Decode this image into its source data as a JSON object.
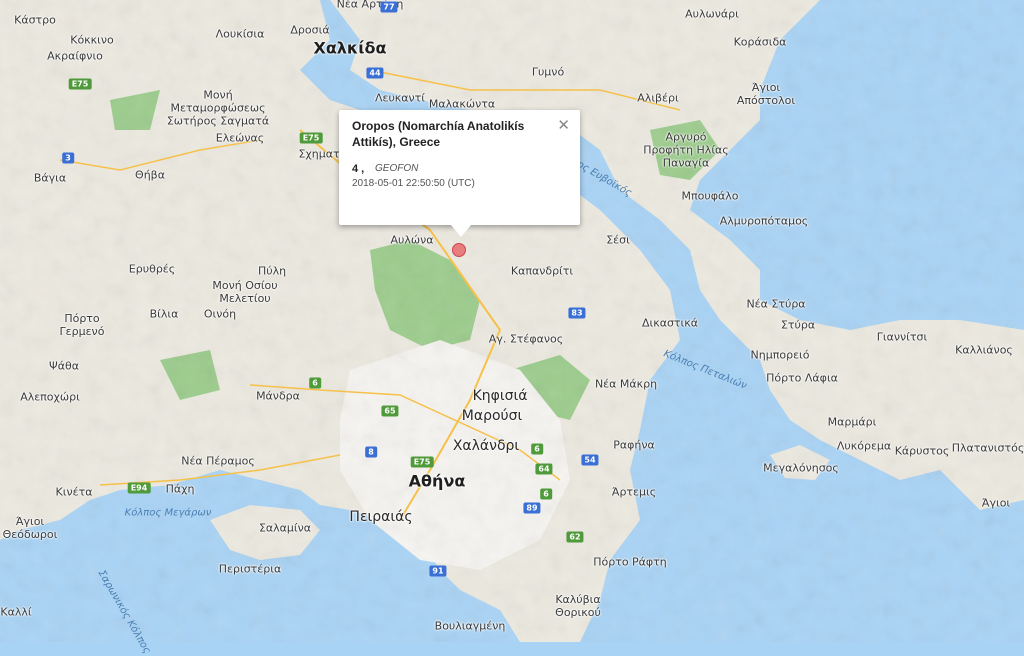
{
  "popup": {
    "title": "Oropos (Nomarchía Anatolikís Attikís), Greece",
    "magnitude": "4 ,",
    "source": "GEOFON",
    "time": "2018-05-01 22:50:50 (UTC)",
    "close_icon": "close-icon"
  },
  "marker": {
    "icon": "earthquake-marker-icon",
    "color": "#e77d7d"
  },
  "colors": {
    "sea": "#a9d3f5",
    "land": "#ece9e0",
    "forest": "#9ccc8c",
    "urban": "#f4f2ee"
  },
  "places": [
    {
      "id": "kastro",
      "name": "Κάστρο"
    },
    {
      "id": "kokkino",
      "name": "Κόκκινο"
    },
    {
      "id": "akraifnio",
      "name": "Ακραίφνιο"
    },
    {
      "id": "loukisia",
      "name": "Λουκίσια"
    },
    {
      "id": "drosia",
      "name": "Δροσιά"
    },
    {
      "id": "chalkida",
      "name": "Χαλκίδα"
    },
    {
      "id": "nea-artaki",
      "name": "Νέα Αρτάκη"
    },
    {
      "id": "avlonari",
      "name": "Αυλωνάρι"
    },
    {
      "id": "korasida",
      "name": "Κοράσιδα"
    },
    {
      "id": "gymno",
      "name": "Γυμνό"
    },
    {
      "id": "moni-metamorfoseos",
      "name": "Μονή Μεταμορφώσεως Σωτήρος Σαγματά"
    },
    {
      "id": "lefkanti",
      "name": "Λευκαντί"
    },
    {
      "id": "malakonta",
      "name": "Μαλακώντα"
    },
    {
      "id": "aliveri",
      "name": "Αλιβέρι"
    },
    {
      "id": "agioi-apostoloi",
      "name": "Άγιοι Απόστολοι"
    },
    {
      "id": "eleonas",
      "name": "Ελεώνας"
    },
    {
      "id": "schimatari",
      "name": "Σχηματάρι"
    },
    {
      "id": "vagia",
      "name": "Βάγια"
    },
    {
      "id": "thiva",
      "name": "Θήβα"
    },
    {
      "id": "argyro",
      "name": "Αργυρό Προφήτη Ηλίας Παναγία"
    },
    {
      "id": "bouffalo",
      "name": "Μπουφάλο"
    },
    {
      "id": "almyropotamos",
      "name": "Αλμυροπόταμος"
    },
    {
      "id": "avlona",
      "name": "Αυλώνα"
    },
    {
      "id": "sesi",
      "name": "Σέσι"
    },
    {
      "id": "kapandriti",
      "name": "Καπανδρίτι"
    },
    {
      "id": "erythres",
      "name": "Ερυθρές"
    },
    {
      "id": "pyli",
      "name": "Πύλη"
    },
    {
      "id": "moni-osiou",
      "name": "Μονή Οσίου Μελετίου"
    },
    {
      "id": "porto-germeno",
      "name": "Πόρτο Γερμενό"
    },
    {
      "id": "vilia",
      "name": "Βίλια"
    },
    {
      "id": "oinoi",
      "name": "Οινόη"
    },
    {
      "id": "dikastika",
      "name": "Δικαστικά"
    },
    {
      "id": "nea-styra",
      "name": "Νέα Στύρα"
    },
    {
      "id": "styra",
      "name": "Στύρα"
    },
    {
      "id": "giannitsi",
      "name": "Γιαννίτσι"
    },
    {
      "id": "kallianos",
      "name": "Καλλιάνος"
    },
    {
      "id": "ag-stefanos",
      "name": "Αγ. Στέφανος"
    },
    {
      "id": "nimporeio",
      "name": "Νημπορειό"
    },
    {
      "id": "porto-lafia",
      "name": "Πόρτο Λάφια"
    },
    {
      "id": "psatha",
      "name": "Ψάθα"
    },
    {
      "id": "kifisia",
      "name": "Κηφισιά"
    },
    {
      "id": "nea-makri",
      "name": "Νέα Μάκρη"
    },
    {
      "id": "alepochori",
      "name": "Αλεποχώρι"
    },
    {
      "id": "mandra",
      "name": "Μάνδρα"
    },
    {
      "id": "marousi",
      "name": "Μαρούσι"
    },
    {
      "id": "marmari",
      "name": "Μαρμάρι"
    },
    {
      "id": "chalandri",
      "name": "Χαλάνδρι"
    },
    {
      "id": "rafina",
      "name": "Ραφήνα"
    },
    {
      "id": "lykorema",
      "name": "Λυκόρεμα"
    },
    {
      "id": "karystos",
      "name": "Κάρυστος"
    },
    {
      "id": "platanistos",
      "name": "Πλατανιστός"
    },
    {
      "id": "nea-peramos",
      "name": "Νέα Πέραμος"
    },
    {
      "id": "megalonisos",
      "name": "Μεγαλόνησος"
    },
    {
      "id": "athina",
      "name": "Αθήνα"
    },
    {
      "id": "kineta",
      "name": "Κινέτα"
    },
    {
      "id": "pachi",
      "name": "Πάχη"
    },
    {
      "id": "artemis",
      "name": "Άρτεμις"
    },
    {
      "id": "agioi-east",
      "name": "Άγιοι"
    },
    {
      "id": "agioi-theodoroi",
      "name": "Άγιοι Θεόδωροι"
    },
    {
      "id": "peiraias",
      "name": "Πειραιάς"
    },
    {
      "id": "salamina",
      "name": "Σαλαμίνα"
    },
    {
      "id": "peristeria",
      "name": "Περιστέρια"
    },
    {
      "id": "porto-rafti",
      "name": "Πόρτο Ράφτη"
    },
    {
      "id": "kalyvia",
      "name": "Καλύβια Θορικού"
    },
    {
      "id": "vouliagmeni",
      "name": "Βουλιαγμένη"
    },
    {
      "id": "kalli",
      "name": "Καλλί"
    }
  ],
  "water_labels": [
    {
      "id": "petalioi",
      "name": "Κόλπος Πεταλιών"
    },
    {
      "id": "megaron",
      "name": "Κόλπος Μεγάρων"
    },
    {
      "id": "evia-strait",
      "name": "Βόρειος Ευβοϊκός"
    },
    {
      "id": "saronikos",
      "name": "Σαρωνικός Κόλπος"
    }
  ],
  "roads": [
    "E75",
    "44",
    "77",
    "3",
    "E75",
    "6",
    "65",
    "8",
    "E94",
    "83",
    "E75",
    "6",
    "64",
    "54",
    "6",
    "89",
    "62",
    "91"
  ]
}
